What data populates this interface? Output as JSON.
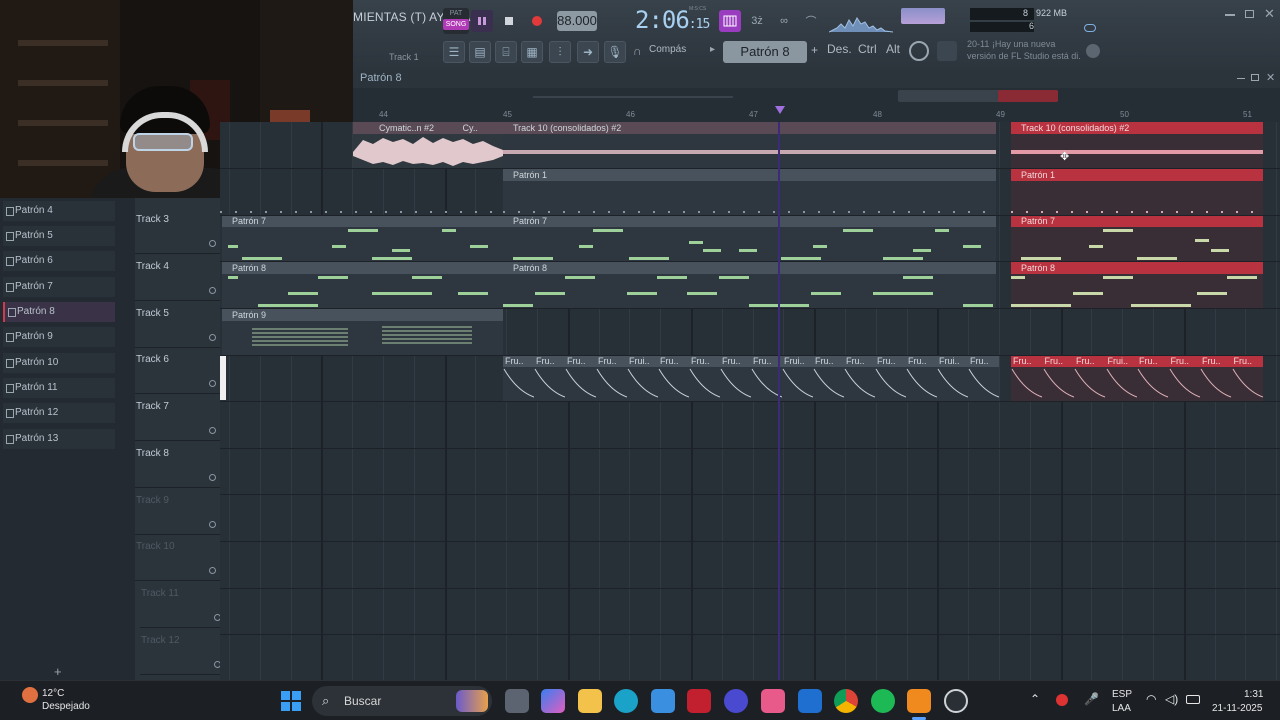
{
  "toolbar": {
    "menu_text": "MIENTAS (T) AYUDA",
    "pat_label": "PAT",
    "song_label": "SONG",
    "tempo": "88.000",
    "time_main": "2:06",
    "time_sub": ":15",
    "time_label": "M:S:CS",
    "cpu_value": "8",
    "mem_value": "922 MB",
    "poly_value": "6",
    "track_hint": "Track 1",
    "snap_label": "Compás",
    "pattern_selector": "Patrón 8",
    "key_shift": "Des.",
    "key_ctrl": "Ctrl",
    "key_alt": "Alt",
    "news_line1": "20-11 ¡Hay una nueva",
    "news_line2": "versión de FL Studio está di."
  },
  "playlist": {
    "title": "Patrón 8",
    "ruler": [
      "44",
      "45",
      "46",
      "47",
      "48",
      "49",
      "50",
      "51"
    ]
  },
  "picker": {
    "items": [
      "Patrón 4",
      "Patrón 5",
      "Patrón 6",
      "Patrón 7",
      "Patrón 8",
      "Patrón 9",
      "Patrón 10",
      "Patrón 11",
      "Patrón 12",
      "Patrón 13"
    ],
    "selected": "Patrón 8",
    "add_label": "+"
  },
  "tracks": [
    "Track 3",
    "Track 4",
    "Track 5",
    "Track 6",
    "Track 7",
    "Track 8",
    "Track 9",
    "Track 10",
    "Track 11",
    "Track 12"
  ],
  "clips": {
    "audio_prev_1": "Cymatic..n #2",
    "audio_prev_2": "Cy..",
    "audio_main": "Track 10 (consolidados) #2",
    "audio_red": "Track 10 (consolidados) #2",
    "pat1": "Patrón 1",
    "pat1_red": "Patrón 1",
    "pat7_a": "Patrón 7",
    "pat7_b": "Patrón 7",
    "pat7_red": "Patrón 7",
    "pat8_a": "Patrón 8",
    "pat8_b": "Patrón 8",
    "pat8_red": "Patrón 8",
    "pat9": "Patrón 9",
    "auto_label": "Fru..",
    "auto_label_alt": "Frui.."
  },
  "taskbar": {
    "weather_temp": "12°C",
    "weather_desc": "Despejado",
    "search_placeholder": "Buscar",
    "lang_1": "ESP",
    "lang_2": "LAA",
    "time": "1:31",
    "date": "21-11-2025"
  },
  "colors": {
    "accent_red": "#b8323f",
    "note_green": "#9ed09a",
    "song_pink": "#b03ab6",
    "playhead": "#3d2a7a"
  }
}
